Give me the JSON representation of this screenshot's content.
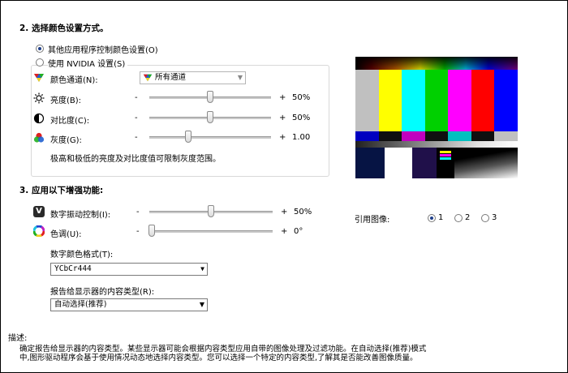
{
  "section2": {
    "title": "2.  选择颜色设置方式。",
    "opt_other": "其他应用程序控制颜色设置(O)",
    "opt_nvidia": "使用  NVIDIA  设置(S)",
    "channel_label": "颜色通道(N):",
    "channel_value": "所有通道",
    "brightness_label": "亮度(B):",
    "brightness_value": "50%",
    "brightness_level": 0.5,
    "contrast_label": "对比度(C):",
    "contrast_value": "50%",
    "contrast_level": 0.5,
    "gamma_label": "灰度(G):",
    "gamma_value": "1.00",
    "gamma_level": 0.32,
    "minus": "-",
    "plus": "+",
    "note": "极高和极低的亮度及对比度值可限制灰度范围。"
  },
  "section3": {
    "title": "3.  应用以下增强功能:",
    "vibrance_label": "数字振动控制(I):",
    "vibrance_value": "50%",
    "vibrance_level": 0.5,
    "hue_label": "色调(U):",
    "hue_value": "0°",
    "hue_level": 0.02,
    "minus": "-",
    "plus": "+",
    "format_label": "数字颜色格式(T):",
    "format_value": "YCbCr444",
    "content_label": "报告给显示器的内容类型(R):",
    "content_value": "自动选择(推荐)"
  },
  "reference": {
    "label": "引用图像:",
    "options": [
      "1",
      "2",
      "3"
    ],
    "selected": "1"
  },
  "description": {
    "title": "描述:",
    "line1": "确定报告给显示器的内容类型。某些显示器可能会根据内容类型应用自带的图像处理及过滤功能。在自动选择(推荐)模式",
    "line2": "中,图形驱动程序会基于使用情况动态地选择内容类型。您可以选择一个特定的内容类型,了解其是否能改善图像质量。"
  },
  "colors": {
    "radio_dot": "#1f3f8a",
    "test_bars": [
      "#c0c0c0",
      "#ffff00",
      "#00ffff",
      "#00d000",
      "#ff00ff",
      "#ff0000",
      "#0000ff"
    ]
  }
}
